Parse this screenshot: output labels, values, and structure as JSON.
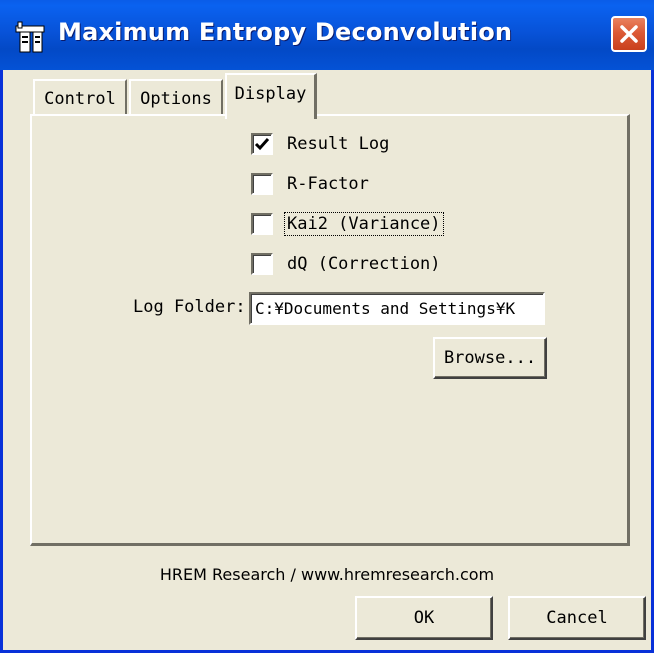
{
  "window": {
    "title": "Maximum Entropy Deconvolution",
    "icon": "app-icon",
    "close_icon": "close-icon"
  },
  "tabs": [
    {
      "label": "Control",
      "active": false
    },
    {
      "label": "Options",
      "active": false
    },
    {
      "label": "Display",
      "active": true
    }
  ],
  "display": {
    "checkboxes": [
      {
        "label": "Result Log",
        "checked": true
      },
      {
        "label": "R-Factor",
        "checked": false
      },
      {
        "label": "Kai2 (Variance)",
        "checked": false
      },
      {
        "label": "dQ (Correction)",
        "checked": false
      }
    ],
    "log_folder_label": "Log Folder:",
    "log_folder_value": "C:¥Documents and Settings¥K",
    "browse_label": "Browse..."
  },
  "footer": {
    "credit": "HREM Research / www.hremresearch.com",
    "ok_label": "OK",
    "cancel_label": "Cancel"
  },
  "colors": {
    "titlebar": "#0853d9",
    "dialog_bg": "#ece9d8",
    "close_button": "#dc5a36"
  }
}
